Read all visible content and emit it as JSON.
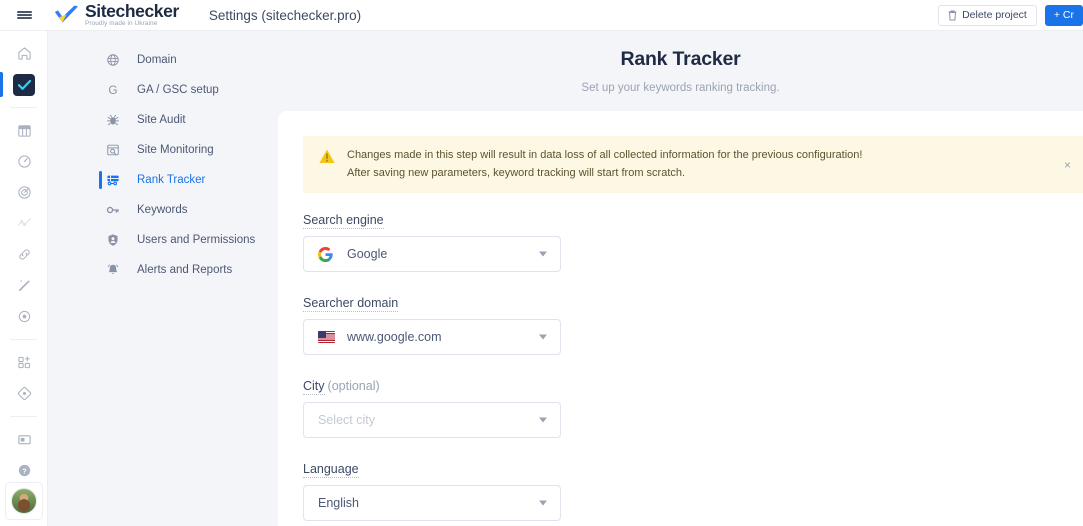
{
  "topbar": {
    "menu_icon": "hamburger-menu-icon",
    "logo_name": "Sitechecker",
    "logo_tagline": "Proudly made in Ukraine",
    "page_context": "Settings (sitechecker.pro)",
    "delete_button": "Delete project",
    "delete_icon": "trash-icon",
    "create_button": "+ Cr",
    "create_icon": "plus-icon"
  },
  "rail": {
    "items": [
      {
        "name": "home-icon",
        "active": false
      },
      {
        "name": "checkmark-projects-icon",
        "active": true
      },
      {
        "name": "table-dashboard-icon",
        "active": false
      },
      {
        "name": "speedometer-icon",
        "active": false
      },
      {
        "name": "target-audit-icon",
        "active": false
      },
      {
        "name": "trend-line-icon",
        "active": false
      },
      {
        "name": "link-chain-icon",
        "active": false
      },
      {
        "name": "magic-wand-icon",
        "active": false
      },
      {
        "name": "crosshair-icon",
        "active": false
      },
      {
        "name": "add-module-icon",
        "active": false
      },
      {
        "name": "diamond-icon",
        "active": false
      },
      {
        "name": "card-billing-icon",
        "active": false
      },
      {
        "name": "help-question-icon",
        "active": false
      }
    ],
    "avatar": "user-avatar"
  },
  "subnav": {
    "items": [
      {
        "label": "Domain",
        "icon": "globe-icon",
        "active": false
      },
      {
        "label": "GA / GSC setup",
        "icon": "google-g-icon",
        "active": false
      },
      {
        "label": "Site Audit",
        "icon": "bug-icon",
        "active": false
      },
      {
        "label": "Site Monitoring",
        "icon": "monitor-search-icon",
        "active": false
      },
      {
        "label": "Rank Tracker",
        "icon": "rank-tracker-icon",
        "active": true
      },
      {
        "label": "Keywords",
        "icon": "key-icon",
        "active": false
      },
      {
        "label": "Users and Permissions",
        "icon": "user-shield-icon",
        "active": false
      },
      {
        "label": "Alerts and Reports",
        "icon": "bell-icon",
        "active": false
      }
    ]
  },
  "main": {
    "title": "Rank Tracker",
    "subtitle": "Set up your keywords ranking tracking.",
    "banner": {
      "icon": "warning-triangle-icon",
      "line1": "Changes made in this step will result in data loss of all collected information for the previous configuration!",
      "line2": "After saving new parameters, keyword tracking will start from scratch.",
      "close_icon": "close-x-icon",
      "close_label": "×"
    },
    "fields": [
      {
        "label": "Search engine",
        "optional": "",
        "icon": "google-multicolor-icon",
        "value": "Google",
        "placeholder": "",
        "is_placeholder": false
      },
      {
        "label": "Searcher domain",
        "optional": "",
        "icon": "us-flag-icon",
        "value": "www.google.com",
        "placeholder": "",
        "is_placeholder": false
      },
      {
        "label": "City",
        "optional": "(optional)",
        "icon": "",
        "value": "",
        "placeholder": "Select city",
        "is_placeholder": true
      },
      {
        "label": "Language",
        "optional": "",
        "icon": "",
        "value": "English",
        "placeholder": "",
        "is_placeholder": false
      }
    ]
  },
  "colors": {
    "accent": "#1a73e8",
    "bg": "#f4f5f8",
    "panel": "#ffffff",
    "warning_bg": "#fdf8e3",
    "warning_icon": "#f5c518",
    "text": "#3d4a63",
    "muted": "#9aa3b4"
  }
}
